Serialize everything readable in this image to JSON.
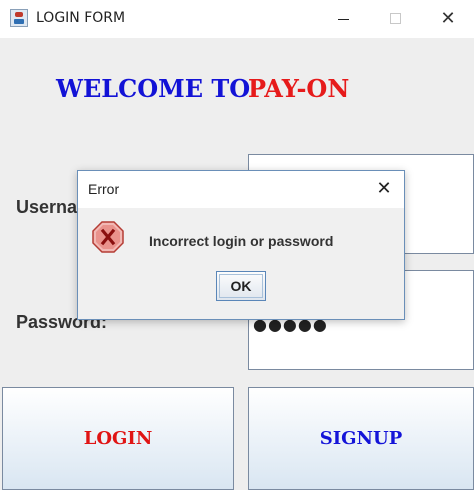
{
  "window": {
    "title": "LOGIN FORM",
    "minimize_icon": "minimize-icon",
    "maximize_icon": "maximize-icon",
    "close_glyph": "✕"
  },
  "welcome": {
    "part1": "WELCOME TO",
    "part2": "PAY-ON"
  },
  "form": {
    "username_label": "Userna",
    "password_label": "Password:",
    "password_value": "●●●●●"
  },
  "buttons": {
    "login": "LOGIN",
    "signup": "SIGNUP"
  },
  "dialog": {
    "title": "Error",
    "close_glyph": "✕",
    "message": "Incorrect login or password",
    "ok_label": "OK",
    "icon": "error-icon"
  },
  "colors": {
    "welcome_blue": "#1212d6",
    "welcome_red": "#e61a1a",
    "error_icon_red": "#c0392b"
  }
}
